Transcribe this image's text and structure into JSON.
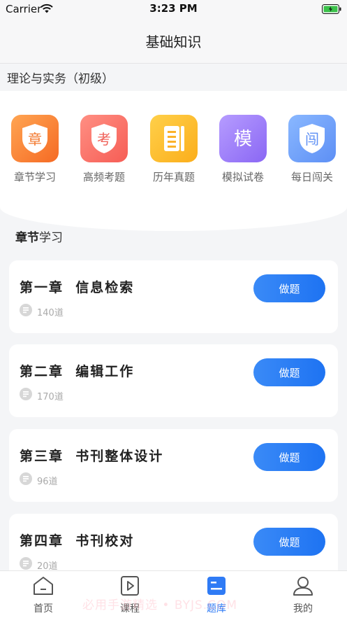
{
  "status": {
    "carrier": "Carrier",
    "time": "3:23 PM"
  },
  "nav": {
    "title": "基础知识"
  },
  "subtitle": "理论与实务（初级）",
  "features": [
    {
      "label": "章节学习",
      "glyph": "章",
      "icon": "chapter-study-icon"
    },
    {
      "label": "高频考题",
      "glyph": "考",
      "icon": "frequent-questions-icon"
    },
    {
      "label": "历年真题",
      "glyph": "",
      "icon": "past-papers-icon"
    },
    {
      "label": "模拟试卷",
      "glyph": "模",
      "icon": "mock-exam-icon"
    },
    {
      "label": "每日闯关",
      "glyph": "闯",
      "icon": "daily-challenge-icon"
    }
  ],
  "section": {
    "title_bold": "章节",
    "title_rest": "学习"
  },
  "chapters": [
    {
      "title": "第一章  信息检索",
      "count": "140道",
      "button": "做题"
    },
    {
      "title": "第二章  编辑工作",
      "count": "170道",
      "button": "做题"
    },
    {
      "title": "第三章  书刊整体设计",
      "count": "96道",
      "button": "做题"
    },
    {
      "title": "第四章  书刊校对",
      "count": "20道",
      "button": "做题"
    }
  ],
  "tabs": [
    {
      "label": "首页",
      "icon": "home-icon"
    },
    {
      "label": "课程",
      "icon": "course-icon"
    },
    {
      "label": "题库",
      "icon": "question-bank-icon",
      "active": true
    },
    {
      "label": "我的",
      "icon": "profile-icon"
    }
  ],
  "watermark": "必用手游精选 • BYJS.COM",
  "colors": {
    "accent": "#2f7bf5",
    "button": "#1e73f2"
  }
}
